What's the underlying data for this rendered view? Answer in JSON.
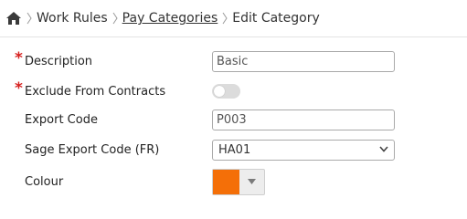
{
  "breadcrumb": {
    "items": [
      {
        "label": "Work Rules",
        "link": false
      },
      {
        "label": "Pay Categories",
        "link": true
      },
      {
        "label": "Edit Category",
        "link": false
      }
    ]
  },
  "form": {
    "required_marker": "*",
    "description": {
      "label": "Description",
      "value": "Basic",
      "required": true
    },
    "exclude_from_contracts": {
      "label": "Exclude From Contracts",
      "checked": false,
      "required": true
    },
    "export_code": {
      "label": "Export Code",
      "value": "P003"
    },
    "sage_export_code": {
      "label": "Sage Export Code (FR)",
      "selected": "HA01"
    },
    "colour": {
      "label": "Colour",
      "value": "#f46f08"
    }
  },
  "icons": [
    "home-icon",
    "chevron-right-icon",
    "chevron-down-icon",
    "caret-down-icon"
  ]
}
